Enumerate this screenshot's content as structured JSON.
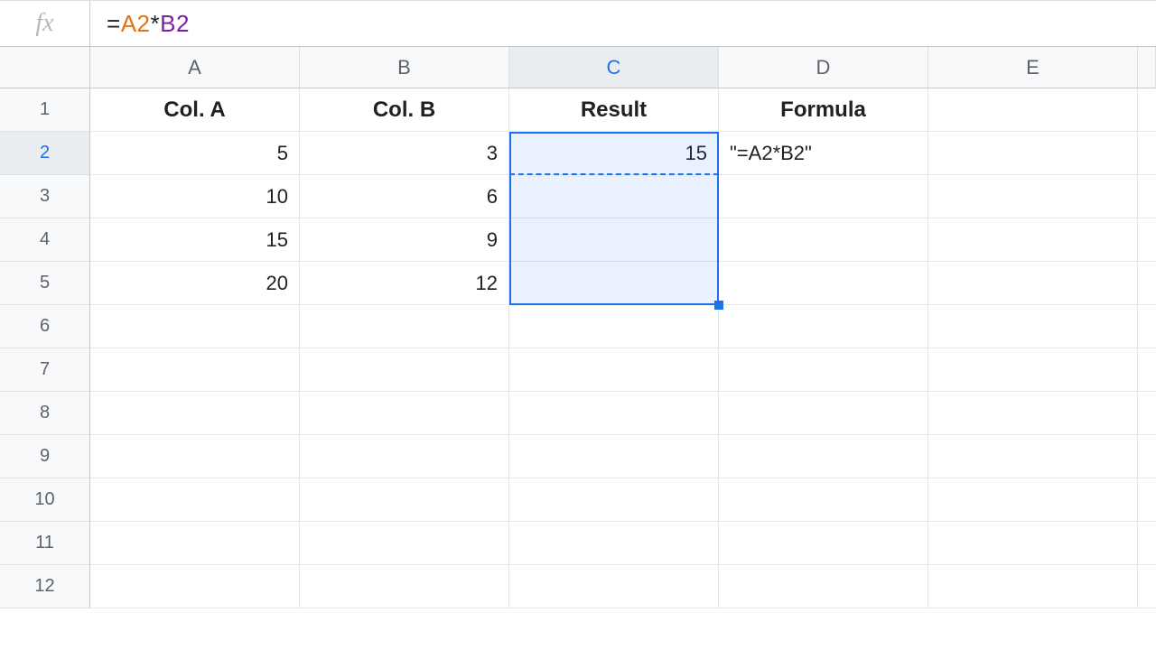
{
  "formula_bar": {
    "fx_label": "fx",
    "tokens": {
      "eq": "=",
      "ref1": "A2",
      "op": "*",
      "ref2": "B2"
    }
  },
  "columns": [
    "A",
    "B",
    "C",
    "D",
    "E"
  ],
  "row_count": 12,
  "headers": {
    "A": "Col. A",
    "B": "Col. B",
    "C": "Result",
    "D": "Formula"
  },
  "data": {
    "A": [
      "5",
      "10",
      "15",
      "20"
    ],
    "B": [
      "3",
      "6",
      "9",
      "12"
    ],
    "C": [
      "15",
      "",
      "",
      ""
    ],
    "D": [
      "\"=A2*B2\"",
      "",
      "",
      ""
    ]
  },
  "selection": {
    "marching_cell": "C2",
    "range": "C2:C5",
    "selected_col": "C",
    "selected_row": 2
  },
  "chart_data": {
    "type": "table",
    "title": "",
    "columns": [
      "Col. A",
      "Col. B",
      "Result",
      "Formula"
    ],
    "rows": [
      [
        5,
        3,
        15,
        "=A2*B2"
      ],
      [
        10,
        6,
        null,
        null
      ],
      [
        15,
        9,
        null,
        null
      ],
      [
        20,
        12,
        null,
        null
      ]
    ]
  }
}
